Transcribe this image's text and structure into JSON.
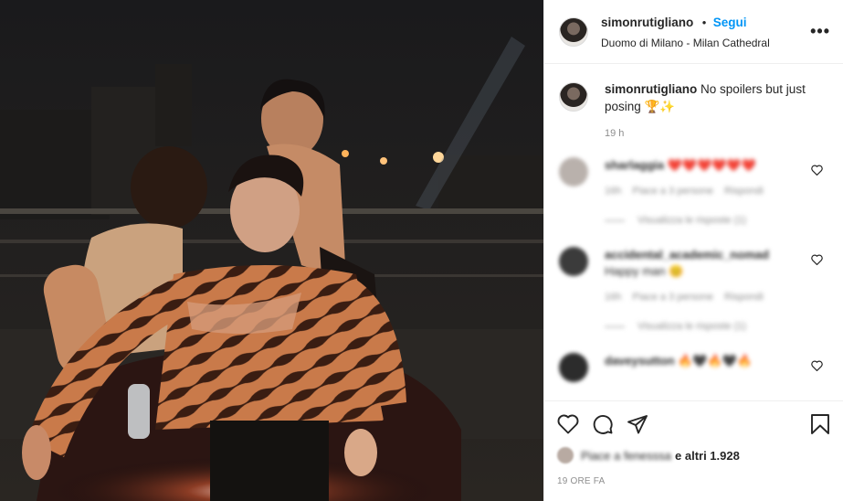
{
  "post": {
    "username": "simonrutigliano",
    "follow_label": "Segui",
    "dot": "•",
    "location": "Duomo di Milano - Milan Cathedral",
    "more_icon": "more-icon",
    "photo_description_icon": "post-photo"
  },
  "caption": {
    "username": "simonrutigliano",
    "text": "No spoilers but just posing 🏆✨",
    "time": "19 h"
  },
  "comments": [
    {
      "username": "sharlaggia",
      "text": "❤️❤️❤️❤️❤️❤️",
      "meta_time": "16h",
      "meta_likes": "Piace a 3 persone",
      "reply": "Rispondi",
      "view_replies": "Visualizza le risposte (1)",
      "avatar_color": "#b9b1ac"
    },
    {
      "username": "accidental_academic_nomad",
      "text": "Happy man 😊",
      "meta_time": "16h",
      "meta_likes": "Piace a 3 persone",
      "reply": "Rispondi",
      "view_replies": "Visualizza le risposte (1)",
      "avatar_color": "#3b3b3b"
    },
    {
      "username": "daveysutton",
      "text": "🔥🖤🔥🖤🔥",
      "meta_time": "",
      "meta_likes": "",
      "reply": "",
      "view_replies": "",
      "avatar_color": "#2c2c2c"
    }
  ],
  "actions": {
    "likes_prefix": "Piace a fenesssa",
    "likes_suffix": "e altri 1.928",
    "age": "19 ORE FA"
  },
  "colors": {
    "accent": "#0095f6",
    "text": "#262626",
    "muted": "#8e8e8e",
    "heart_red": "#ed4956"
  }
}
